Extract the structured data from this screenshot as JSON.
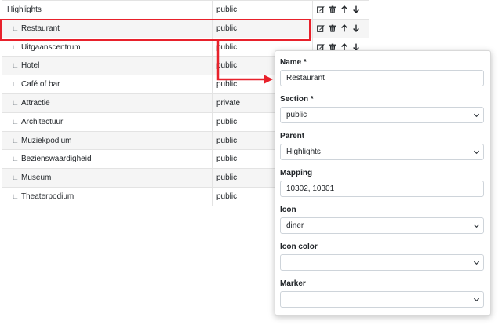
{
  "table": {
    "rows": [
      {
        "name": "Highlights",
        "section": "public",
        "child": false
      },
      {
        "name": "Restaurant",
        "section": "public",
        "child": true
      },
      {
        "name": "Uitgaanscentrum",
        "section": "public",
        "child": true
      },
      {
        "name": "Hotel",
        "section": "public",
        "child": true
      },
      {
        "name": "Café of bar",
        "section": "public",
        "child": true
      },
      {
        "name": "Attractie",
        "section": "private",
        "child": true
      },
      {
        "name": "Architectuur",
        "section": "public",
        "child": true
      },
      {
        "name": "Muziekpodium",
        "section": "public",
        "child": true
      },
      {
        "name": "Bezienswaardigheid",
        "section": "public",
        "child": true
      },
      {
        "name": "Museum",
        "section": "public",
        "child": true
      },
      {
        "name": "Theaterpodium",
        "section": "public",
        "child": true
      }
    ],
    "child_marker": "∟",
    "action_icons": [
      "edit-icon",
      "trash-icon",
      "arrow-up-icon",
      "arrow-down-icon"
    ]
  },
  "annotation": {
    "color": "#e8212b"
  },
  "form": {
    "name": {
      "label": "Name *",
      "value": "Restaurant"
    },
    "section": {
      "label": "Section *",
      "value": "public"
    },
    "parent": {
      "label": "Parent",
      "value": "Highlights"
    },
    "mapping": {
      "label": "Mapping",
      "value": "10302, 10301"
    },
    "icon": {
      "label": "Icon",
      "value": "diner"
    },
    "icon_color": {
      "label": "Icon color",
      "value": ""
    },
    "marker": {
      "label": "Marker",
      "value": ""
    }
  }
}
